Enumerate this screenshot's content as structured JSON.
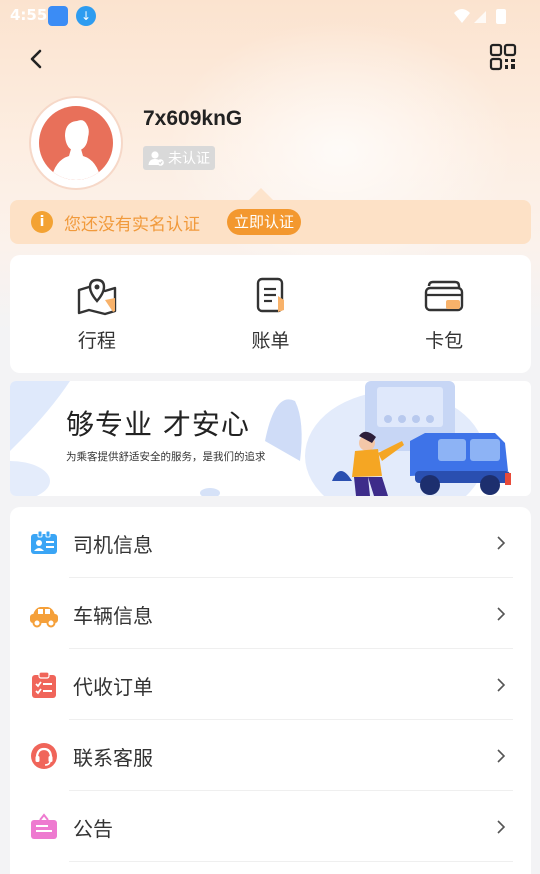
{
  "status_bar": {
    "time": "4:55"
  },
  "header": {
    "back_icon": "chevron-left-icon",
    "qr_icon": "qr-code-icon"
  },
  "profile": {
    "username": "7x609knG",
    "verify_status": "未认证"
  },
  "notice": {
    "text": "您还没有实名认证",
    "button": "立即认证",
    "icon": "info-icon"
  },
  "quick_actions": [
    {
      "label": "行程",
      "icon": "map-pin-icon"
    },
    {
      "label": "账单",
      "icon": "bill-icon"
    },
    {
      "label": "卡包",
      "icon": "wallet-icon"
    }
  ],
  "banner": {
    "title": "够专业 才安心",
    "subtitle": "为乘客提供舒适安全的服务，是我们的追求"
  },
  "menu": [
    {
      "label": "司机信息",
      "icon": "driver-card-icon",
      "color": "#3aa5f5"
    },
    {
      "label": "车辆信息",
      "icon": "car-icon",
      "color": "#f5a03a"
    },
    {
      "label": "代收订单",
      "icon": "clipboard-icon",
      "color": "#f0655a"
    },
    {
      "label": "联系客服",
      "icon": "headset-icon",
      "color": "#f0655a"
    },
    {
      "label": "公告",
      "icon": "briefcase-icon",
      "color": "#ee7ad0"
    }
  ],
  "colors": {
    "accent": "#f3982f",
    "notice_bg": "#fde1c6",
    "avatar": "#e8705a"
  }
}
